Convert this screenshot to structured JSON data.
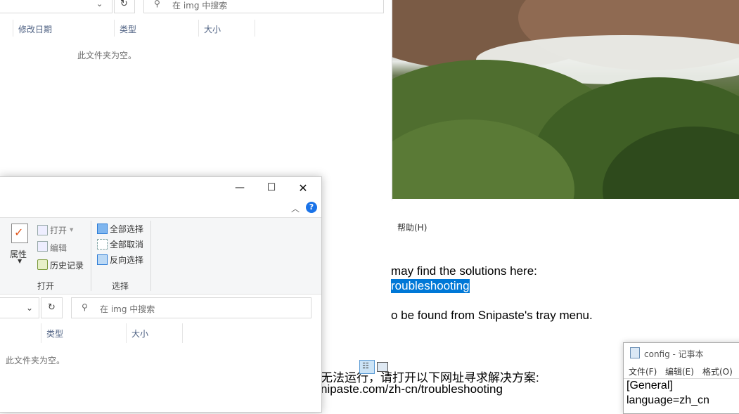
{
  "back_window": {
    "search_placeholder": "在 img 中搜索",
    "columns": [
      "修改日期",
      "类型",
      "大小"
    ],
    "empty_text": "此文件夹为空。"
  },
  "notepad_background": {
    "menu_help": "帮助(H)",
    "lines": [
      "may find the solutions here:",
      "roubleshooting",
      "o be found from Snipaste's tray menu.",
      "无法运行，请打开以下网址寻求解决方案:",
      "nipaste.com/zh-cn/troubleshooting"
    ]
  },
  "front_window": {
    "ribbon": {
      "properties_label": "属性",
      "open_items": [
        "打开",
        "编辑",
        "历史记录"
      ],
      "open_group_label": "打开",
      "select_items": [
        "全部选择",
        "全部取消",
        "反向选择"
      ],
      "select_group_label": "选择"
    },
    "search_placeholder": "在 img 中搜索",
    "columns": [
      "类型",
      "大小"
    ],
    "empty_text": "此文件夹为空。"
  },
  "notepad_small": {
    "title": "config - 记事本",
    "menu": [
      "文件(F)",
      "编辑(E)",
      "格式(O)"
    ],
    "lines": [
      "[General]",
      "language=zh_cn"
    ]
  },
  "colors": {
    "selection": "#0078d7",
    "help_icon": "#1a73e8"
  }
}
